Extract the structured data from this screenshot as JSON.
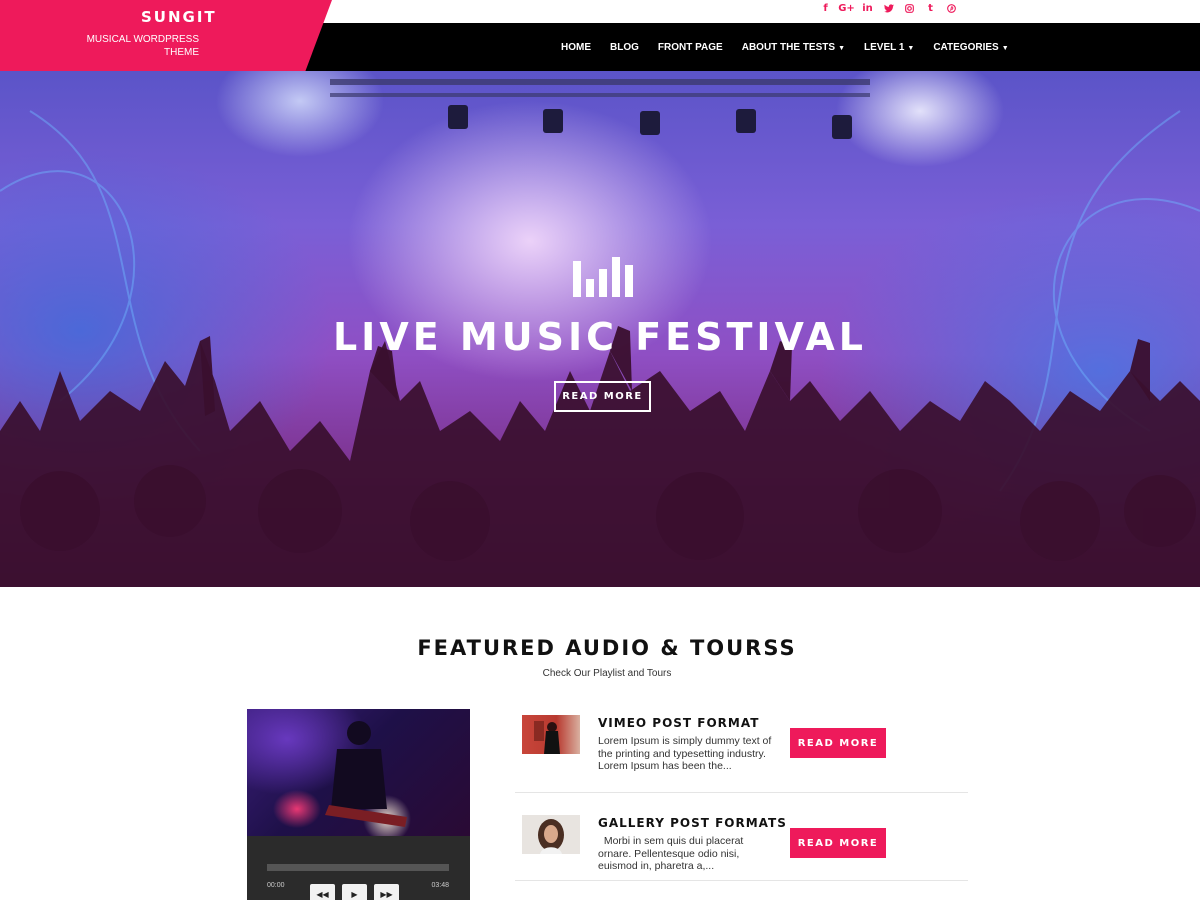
{
  "site": {
    "title": "SUNGIT",
    "tagline": "MUSICAL WORDPRESS THEME",
    "brand_color": "#ee1a5b"
  },
  "social": [
    {
      "icon": "facebook-icon",
      "glyph": "f"
    },
    {
      "icon": "google-plus-icon",
      "glyph": "G+"
    },
    {
      "icon": "linkedin-icon",
      "glyph": "in"
    },
    {
      "icon": "twitter-icon",
      "glyph": "🐦"
    },
    {
      "icon": "instagram-icon",
      "glyph": "◎"
    },
    {
      "icon": "tumblr-icon",
      "glyph": "t"
    },
    {
      "icon": "pinterest-icon",
      "glyph": "℗"
    }
  ],
  "nav": {
    "items": [
      {
        "label": "HOME",
        "dropdown": false
      },
      {
        "label": "BLOG",
        "dropdown": false
      },
      {
        "label": "FRONT PAGE",
        "dropdown": false
      },
      {
        "label": "ABOUT THE TESTS",
        "dropdown": true
      },
      {
        "label": "LEVEL 1",
        "dropdown": true
      },
      {
        "label": "CATEGORIES",
        "dropdown": true
      }
    ]
  },
  "hero": {
    "icon": "equalizer-bars-icon",
    "title": "LIVE MUSIC FESTIVAL",
    "button": "READ MORE"
  },
  "featured": {
    "title": "FEATURED AUDIO & TOURSS",
    "subtitle": "Check Our Playlist and Tours"
  },
  "player": {
    "current_time": "00:00",
    "duration": "03:48",
    "progress": 0,
    "controls": [
      {
        "icon": "rewind-icon",
        "glyph": "◀◀"
      },
      {
        "icon": "play-icon",
        "glyph": "▶"
      },
      {
        "icon": "fast-forward-icon",
        "glyph": "▶▶"
      }
    ]
  },
  "posts": [
    {
      "title": "VIMEO POST FORMAT",
      "excerpt": "Lorem Ipsum is simply dummy text of the printing and typesetting industry. Lorem Ipsum has been the...",
      "button": "READ MORE"
    },
    {
      "title": "GALLERY POST FORMATS",
      "excerpt": "  Morbi in sem quis dui placerat ornare. Pellentesque odio nisi, euismod in, pharetra a,...",
      "button": "READ MORE"
    }
  ]
}
